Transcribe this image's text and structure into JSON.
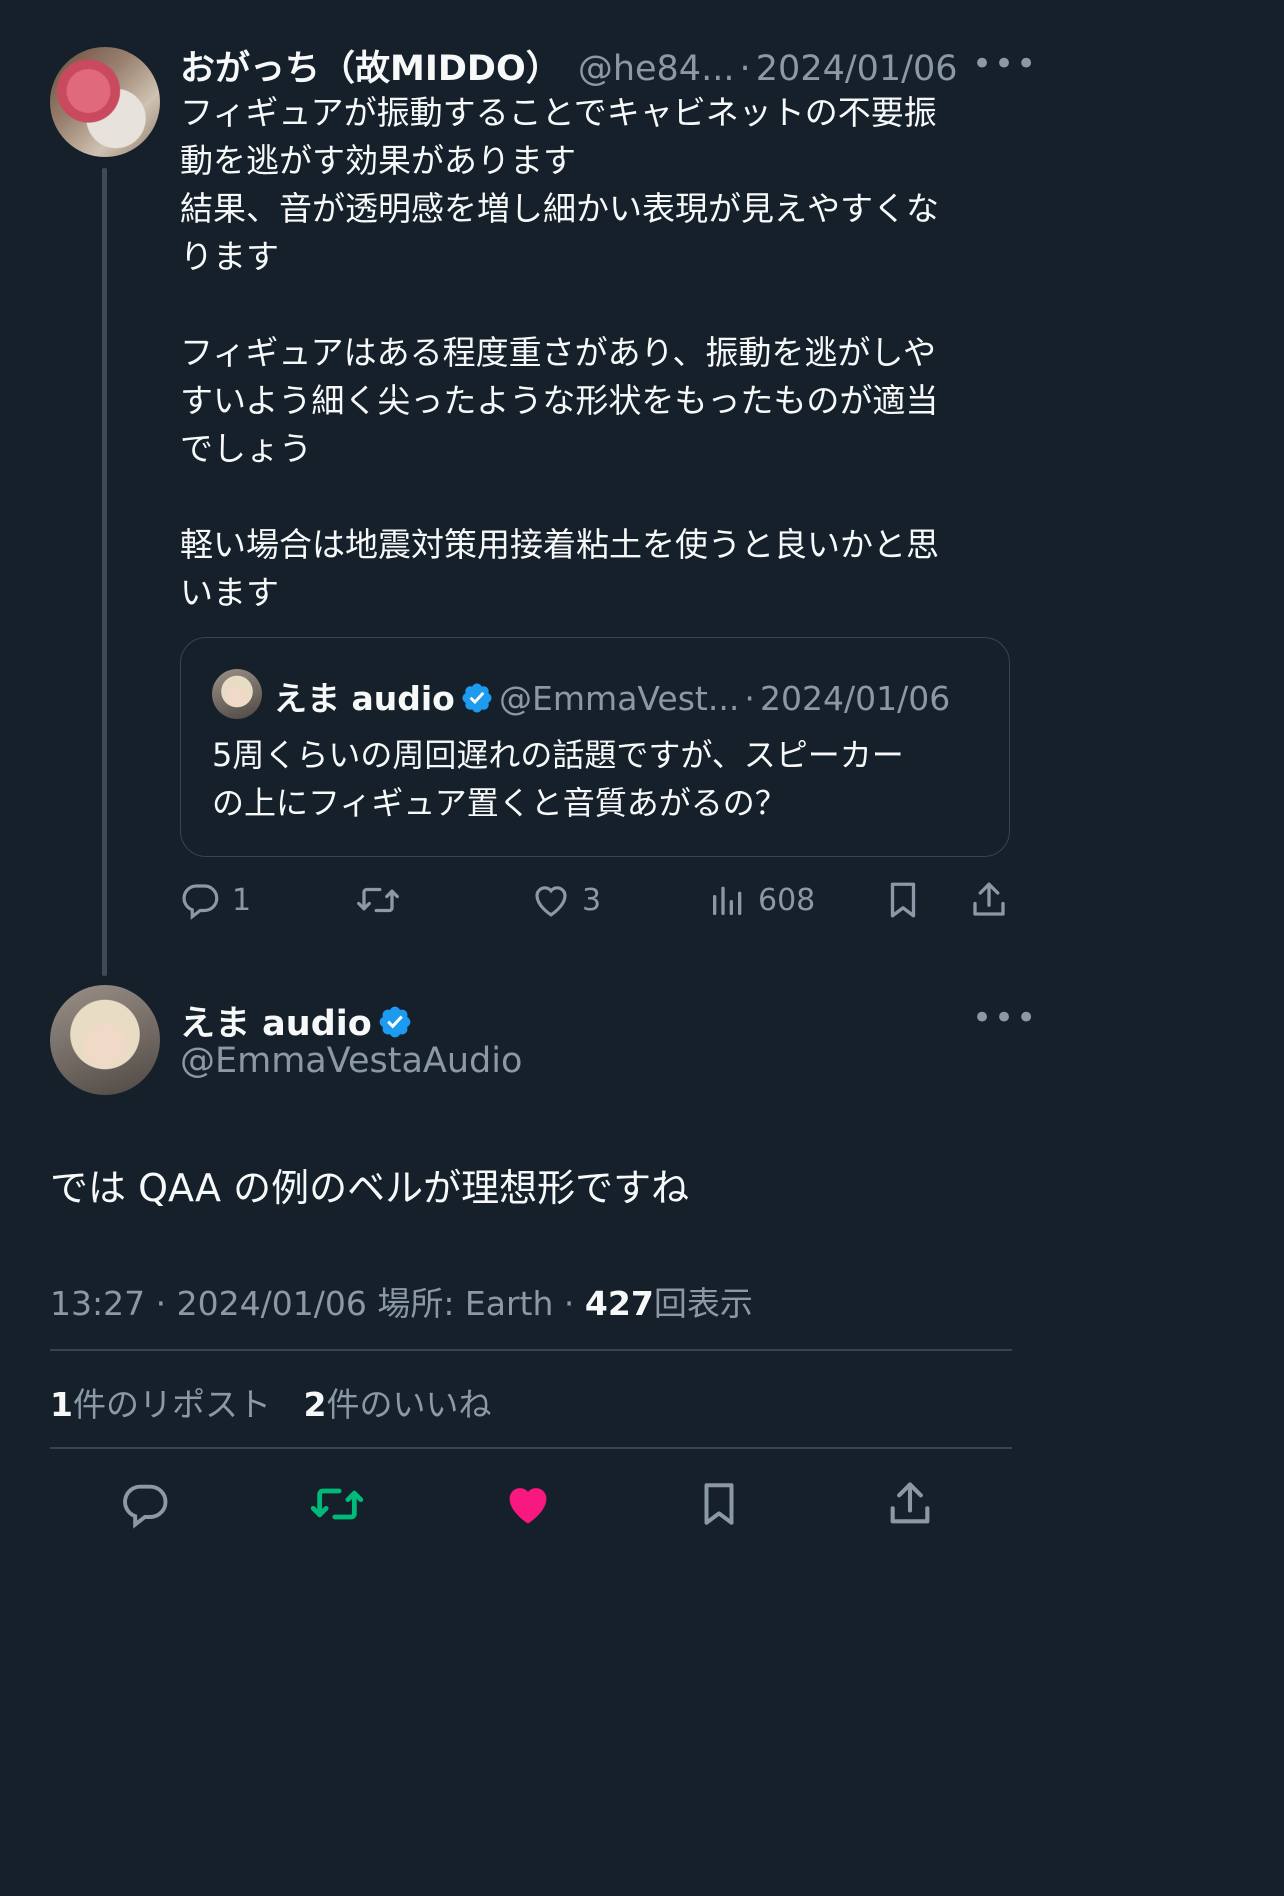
{
  "parent_tweet": {
    "display_name": "おがっち（故MIDDO）",
    "handle": "@he84...",
    "sep": "·",
    "date": "2024/01/06",
    "more": "•••",
    "text": "フィギュアが振動することでキャビネットの不要振\n動を逃がす効果があります\n結果、音が透明感を増し細かい表現が見えやすくな\nります\n\nフィギュアはある程度重さがあり、振動を逃がしや\nすいよう細く尖ったような形状をもったものが適当\nでしょう\n\n軽い場合は地震対策用接着粘土を使うと良いかと思\nいます",
    "quote": {
      "display_name": "えま audio",
      "handle": "@EmmaVest...",
      "sep": "·",
      "date": "2024/01/06",
      "text": "5周くらいの周回遅れの話題ですが、スピーカー\nの上にフィギュア置くと音質あがるの？"
    },
    "actions": {
      "reply_count": "1",
      "retweet_count": "",
      "like_count": "3",
      "view_count": "608"
    }
  },
  "main_tweet": {
    "display_name": "えま audio",
    "handle": "@EmmaVestaAudio",
    "more": "•••",
    "text": "では QAA の例のベルが理想形ですね",
    "time": "13:27",
    "sep1": "·",
    "date": "2024/01/06",
    "location_label": "場所: Earth",
    "sep2": "·",
    "views": "427",
    "views_label": "回表示",
    "repost_count": "1",
    "repost_label": "件のリポスト",
    "like_count": "2",
    "like_label": "件のいいね"
  },
  "colors": {
    "background": "#15202b",
    "text": "#f7f9f9",
    "muted": "#8b98a5",
    "verified": "#1d9bf0",
    "retweeted": "#00ba7c",
    "liked": "#f91880"
  }
}
